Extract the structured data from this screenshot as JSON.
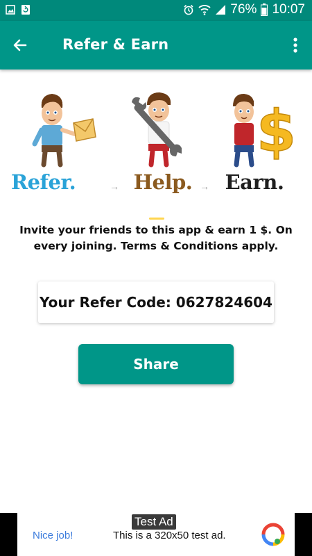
{
  "status_bar": {
    "battery": "76%",
    "time": "10:07",
    "icons": [
      "image-icon",
      "recycle-icon",
      "alarm-icon",
      "wifi-icon",
      "signal-icon",
      "battery-icon"
    ]
  },
  "app_bar": {
    "title": "Refer & Earn",
    "back_icon": "arrow-back-icon",
    "menu_icon": "more-vertical-icon"
  },
  "illustration": {
    "steps": [
      {
        "label": "Refer.",
        "color": "#2aa3d8"
      },
      {
        "label": "Help.",
        "color": "#8b5a1f"
      },
      {
        "label": "Earn.",
        "color": "#1f1f1f"
      }
    ],
    "separator": "→"
  },
  "invite": {
    "text": "Invite your friends to this app & earn 1 $. On every joining. Terms & Conditions apply."
  },
  "refer_code": {
    "text": "Your Refer Code: 0627824604"
  },
  "share_button": {
    "label": "Share"
  },
  "ad": {
    "tag": "Test Ad",
    "nice": "Nice job!",
    "text": "This is a 320x50 test ad."
  },
  "colors": {
    "primary": "#009688",
    "status_bar": "#00897b",
    "link": "#3b7bdc"
  }
}
